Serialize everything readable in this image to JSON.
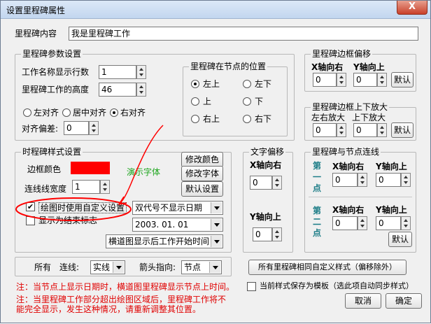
{
  "window": {
    "title": "设置里程碑属性",
    "close_label": "X"
  },
  "milestone_content": {
    "label": "里程碑内容",
    "value": "我是里程碑工作"
  },
  "params": {
    "title": "里程碑参数设置",
    "name_rows_label": "工作名称显示行数",
    "name_rows_value": "1",
    "height_label": "里程碑工作的高度",
    "height_value": "46",
    "align_left": "左对齐",
    "align_center": "居中对齐",
    "align_right": "右对齐",
    "align_offset_label": "对齐偏差:",
    "align_offset_value": "0"
  },
  "node_position": {
    "title": "里程碑在节点的位置",
    "top_left": "左上",
    "bottom_left": "左下",
    "top": "上",
    "bottom": "下",
    "top_right": "右上",
    "bottom_right": "右下"
  },
  "border_offset": {
    "title": "里程碑边框偏移",
    "x_label": "X轴向右",
    "y_label": "Y轴向上",
    "x_value": "0",
    "y_value": "0",
    "default_label": "默认"
  },
  "border_zoom": {
    "title": "里程碑边框上下放大",
    "left_right_label": "左右放大",
    "up_down_label": "上下放大",
    "lr_value": "0",
    "ud_value": "0",
    "default_label": "默认"
  },
  "style": {
    "title": "时程碑样式设置",
    "border_color_label": "边框颜色",
    "border_color": "#ff0000",
    "demo_font_label": "演示字体",
    "line_width_label": "连线线宽度",
    "line_width_value": "1",
    "modify_color_label": "修改颜色",
    "modify_font_label": "修改字体",
    "default_setting_label": "默认设置",
    "custom_check_label": "绘图时使用自定义设置",
    "end_flag_label": "显示为结束标志",
    "date_format_value": "双代号不显示日期",
    "date_value": "2003. 01. 01",
    "display_mode_value": "横道图显示后工作开始时间"
  },
  "text_offset": {
    "title": "文字偏移",
    "x_label": "X轴向右",
    "y_label": "Y轴向上",
    "x_value": "0",
    "y_value": "0"
  },
  "node_link": {
    "title": "里程碑与节点连线",
    "first_point_label": "第一点",
    "second_point_label": "第二点",
    "x_label": "X轴向右",
    "y_label": "Y轴向上",
    "p1_x": "0",
    "p1_y": "0",
    "p2_x": "0",
    "p2_y": "0",
    "default_label": "默认"
  },
  "bottom_bar": {
    "all_label": "所有",
    "line_label": "连线:",
    "line_value": "实线",
    "arrow_label": "箭头指向:",
    "arrow_value": "节点"
  },
  "apply_all_label": "所有里程碑相同自定义样式（偏移除外）",
  "save_template_label": "当前样式保存为模板（选此项自动同步样式）",
  "notes": {
    "note1": "注：当节点上显示日期时，横道图里程碑显示节点上时间。",
    "note2a": "注：当里程碑工作部分超出绘图区域后，里程碑工作将不",
    "note2b": "能完全显示，发生这种情况，请重新调整其位置。"
  },
  "cancel_label": "取消",
  "ok_label": "确定"
}
